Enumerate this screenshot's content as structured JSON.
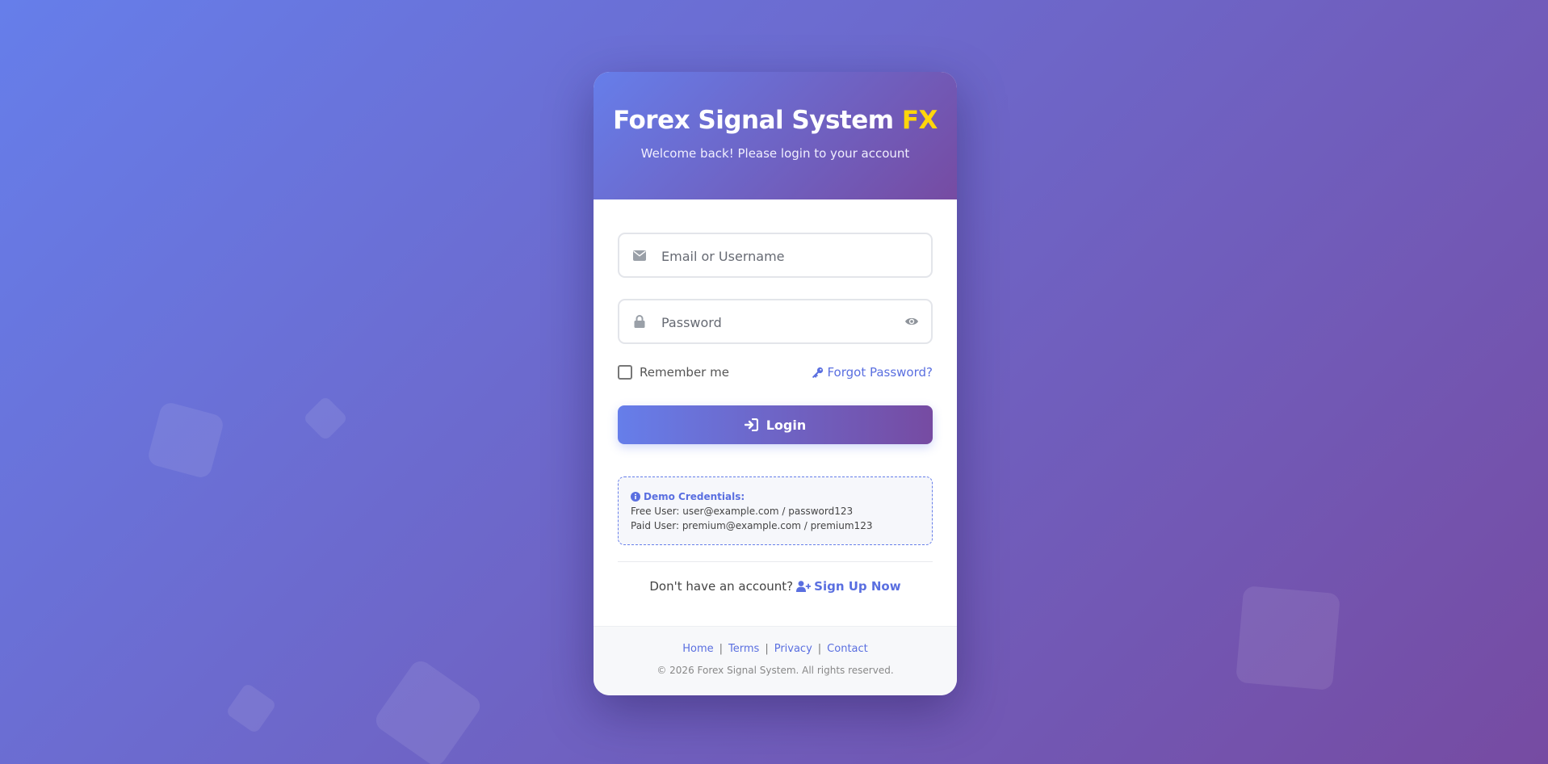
{
  "brand": {
    "title_main": "Forex Signal System",
    "title_accent": "FX",
    "subtitle": "Welcome back! Please login to your account"
  },
  "form": {
    "email_placeholder": "Email or Username",
    "email_value": "",
    "password_placeholder": "Password",
    "password_value": "",
    "remember_label": "Remember me",
    "forgot_label": "Forgot Password?",
    "login_label": "Login"
  },
  "demo": {
    "title": "Demo Credentials:",
    "lines": [
      "Free User: user@example.com / password123",
      "Paid User: premium@example.com / premium123"
    ]
  },
  "signup": {
    "prompt": "Don't have an account?",
    "link": "Sign Up Now"
  },
  "footer": {
    "links": [
      "Home",
      "Terms",
      "Privacy",
      "Contact"
    ],
    "copyright": "© 2026 Forex Signal System. All rights reserved."
  },
  "colors": {
    "gradient_start": "#667eea",
    "gradient_end": "#764ba2",
    "accent_yellow": "#ffd60a",
    "link": "#5a6fe0"
  },
  "icons": [
    "envelope-icon",
    "lock-icon",
    "eye-icon",
    "key-icon",
    "sign-in-icon",
    "info-icon",
    "user-plus-icon"
  ]
}
